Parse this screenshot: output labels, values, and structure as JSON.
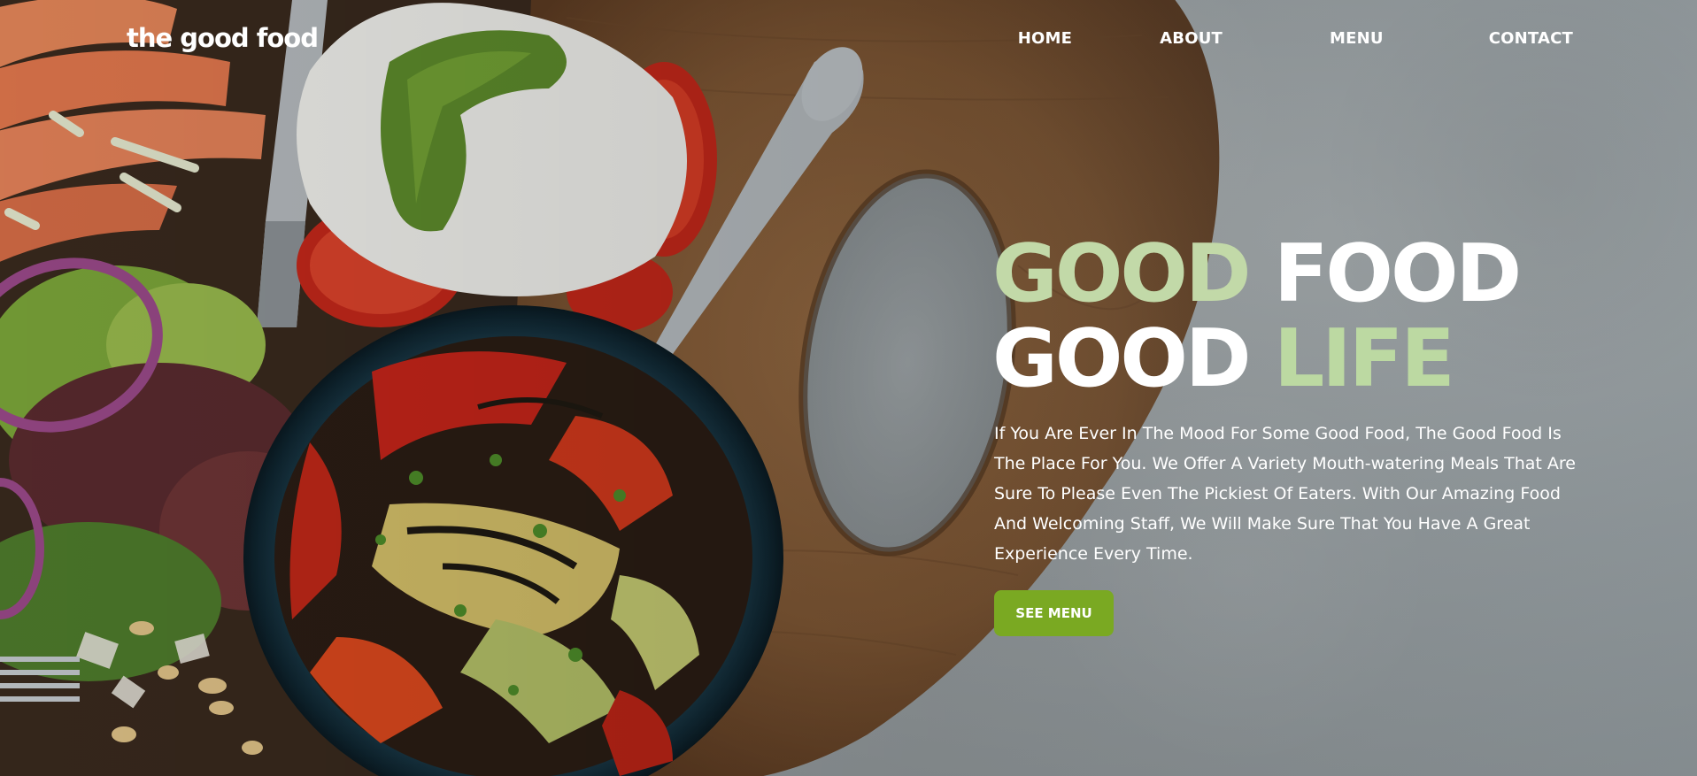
{
  "brand": {
    "name": "the good food"
  },
  "nav": {
    "items": [
      {
        "label": "HOME"
      },
      {
        "label": "ABOUT"
      },
      {
        "label": "MENU"
      },
      {
        "label": "CONTACT"
      }
    ]
  },
  "hero": {
    "line1": {
      "accent": "GOOD",
      "rest": "FOOD"
    },
    "line2": {
      "rest": "GOOD",
      "accent": "LIFE"
    },
    "description": "If You Are Ever In The Mood For Some Good Food, The Good Food Is The Place For You. We Offer A Variety Mouth-watering Meals That Are Sure To Please Even The Pickiest Of Eaters. With Our Amazing Food And Welcoming Staff, We Will Make Sure That You Have A Great Experience Every Time.",
    "cta_label": "SEE MENU"
  },
  "colors": {
    "accent_green": "#c2d9a8",
    "button_green": "#7aa922",
    "text": "#ffffff",
    "background_stone": "#a6adb0"
  }
}
